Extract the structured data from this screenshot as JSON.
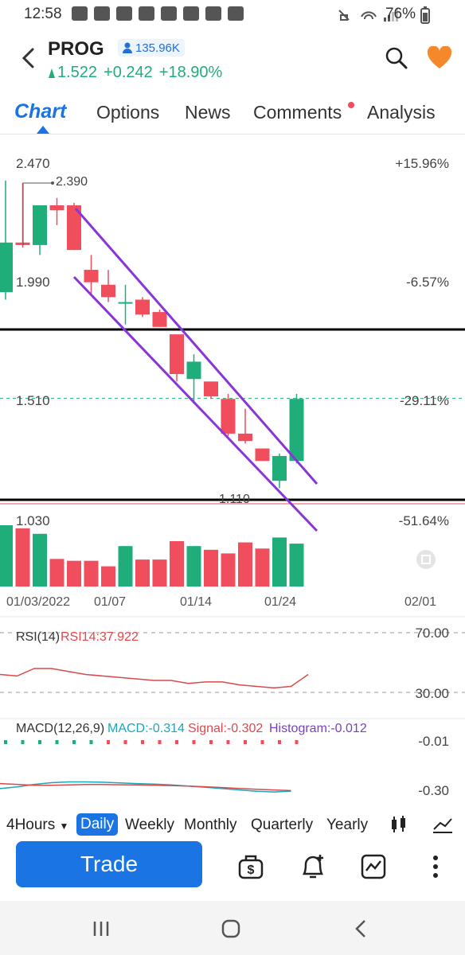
{
  "status_bar": {
    "time": "12:58",
    "battery": "76%"
  },
  "header": {
    "ticker": "PROG",
    "followers": "135.96K",
    "price": "1.522",
    "change": "+0.242",
    "change_pct": "+18.90%",
    "up_color": "#1fae7a",
    "down_color": "#f04d5d",
    "accent": "#1a74e4"
  },
  "tabs": [
    "Chart",
    "Options",
    "News",
    "Comments",
    "Analysis"
  ],
  "chart": {
    "y_left": [
      "2.470",
      "1.990",
      "1.510",
      "1.030"
    ],
    "y_right": [
      "+15.96%",
      "-6.57%",
      "-29.11%",
      "-51.64%"
    ],
    "high_label": "2.390",
    "low_label": "1.110",
    "x_labels": [
      "01/03/2022",
      "01/07",
      "01/14",
      "01/24",
      "02/01"
    ]
  },
  "chart_data": {
    "type": "candlestick",
    "ylim": [
      1.03,
      2.47
    ],
    "candles": [
      {
        "open": 1.95,
        "high": 2.4,
        "low": 1.92,
        "close": 2.15
      },
      {
        "open": 2.15,
        "high": 2.39,
        "low": 2.13,
        "close": 2.14
      },
      {
        "open": 2.14,
        "high": 2.3,
        "low": 2.1,
        "close": 2.3
      },
      {
        "open": 2.3,
        "high": 2.33,
        "low": 2.22,
        "close": 2.28
      },
      {
        "open": 2.3,
        "high": 2.31,
        "low": 2.12,
        "close": 2.12
      },
      {
        "open": 2.04,
        "high": 2.1,
        "low": 1.94,
        "close": 1.99
      },
      {
        "open": 1.98,
        "high": 2.04,
        "low": 1.91,
        "close": 1.93
      },
      {
        "open": 1.91,
        "high": 1.98,
        "low": 1.82,
        "close": 1.91
      },
      {
        "open": 1.92,
        "high": 1.93,
        "low": 1.85,
        "close": 1.86
      },
      {
        "open": 1.87,
        "high": 1.88,
        "low": 1.81,
        "close": 1.81
      },
      {
        "open": 1.78,
        "high": 1.78,
        "low": 1.59,
        "close": 1.62
      },
      {
        "open": 1.6,
        "high": 1.7,
        "low": 1.5,
        "close": 1.67
      },
      {
        "open": 1.59,
        "high": 1.59,
        "low": 1.52,
        "close": 1.53
      },
      {
        "open": 1.52,
        "high": 1.54,
        "low": 1.37,
        "close": 1.38
      },
      {
        "open": 1.38,
        "high": 1.48,
        "low": 1.34,
        "close": 1.35
      },
      {
        "open": 1.32,
        "high": 1.32,
        "low": 1.27,
        "close": 1.27
      },
      {
        "open": 1.19,
        "high": 1.3,
        "low": 1.16,
        "close": 1.29
      },
      {
        "open": 1.27,
        "high": 1.54,
        "low": 1.26,
        "close": 1.52
      }
    ],
    "volume": [
      10,
      9.5,
      8.6,
      4.5,
      4.2,
      4.2,
      3.3,
      6.6,
      4.4,
      4.4,
      7.4,
      6.6,
      6.0,
      5.4,
      7.2,
      6.2,
      8.0,
      7.0
    ],
    "rsi": {
      "label": "RSI(14)",
      "value_label": "RSI14:37.922",
      "levels": [
        "70.00",
        "30.00"
      ],
      "values": [
        42,
        41,
        46,
        46,
        44,
        42,
        41,
        40,
        39,
        38,
        38,
        36,
        37,
        37,
        35,
        34,
        33,
        34,
        42
      ]
    },
    "macd": {
      "label": "MACD(12,26,9)",
      "macd_label": "MACD:-0.314",
      "signal_label": "Signal:-0.302",
      "hist_label": "Histogram:-0.012",
      "levels": [
        "-0.01",
        "-0.30"
      ]
    }
  },
  "periods": [
    "4Hours",
    "Daily",
    "Weekly",
    "Monthly",
    "Quarterly",
    "Yearly"
  ],
  "actions": {
    "trade_label": "Trade"
  }
}
